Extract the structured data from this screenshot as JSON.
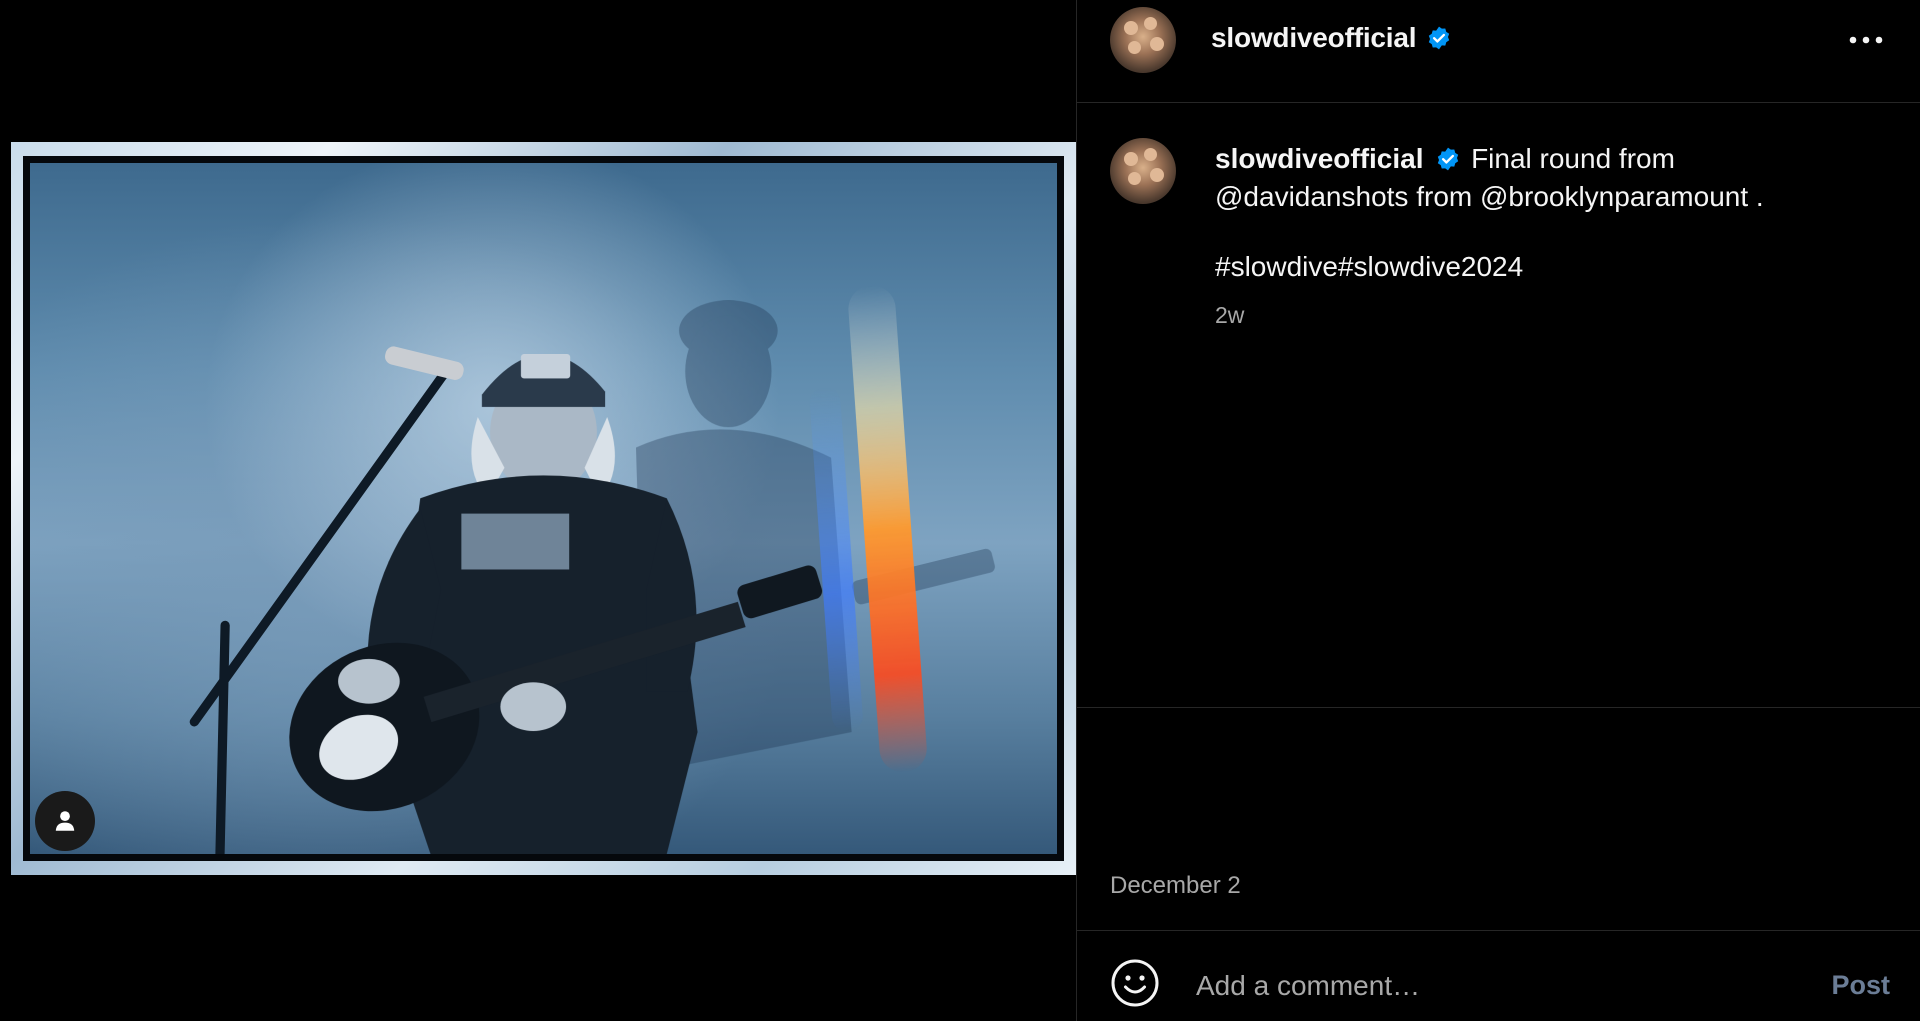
{
  "post": {
    "author": "slowdiveofficial",
    "verified": true,
    "caption": {
      "text_before": "Final round from ",
      "mention_1": "@davidanshots",
      "text_middle": " from ",
      "mention_2": "@brooklynparamount",
      "text_after": " ."
    },
    "hashtags": [
      "#slowdive",
      "#slowdive2024"
    ],
    "age": "2w",
    "date": "December 2"
  },
  "comment": {
    "placeholder": "Add a comment…",
    "post_label": "Post"
  },
  "icons": {
    "more": "more-horizontal-icon",
    "verified": "verified-badge-icon",
    "emoji": "emoji-smile-icon",
    "user_tag": "user-tag-icon"
  },
  "colors": {
    "background": "#000000",
    "text": "#f5f5f5",
    "secondary_text": "#a8a8a8",
    "verified": "#0095f6",
    "post_button_disabled": "#6b7d96",
    "divider": "#262626"
  }
}
